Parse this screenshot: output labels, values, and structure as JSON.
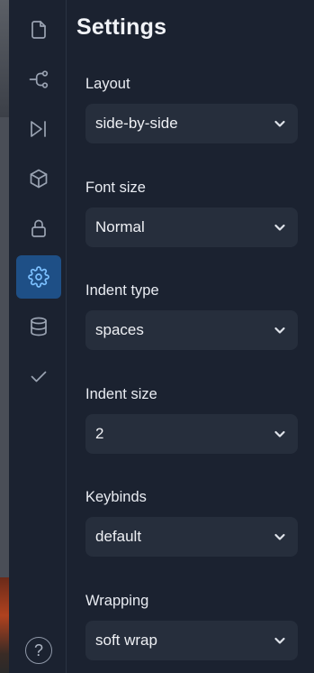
{
  "activity_bar": {
    "items": [
      {
        "name": "file-icon"
      },
      {
        "name": "git-branch-icon"
      },
      {
        "name": "run-next-icon"
      },
      {
        "name": "package-icon"
      },
      {
        "name": "lock-icon"
      },
      {
        "name": "settings-gear-icon",
        "active": true
      },
      {
        "name": "database-icon"
      },
      {
        "name": "checkmark-icon"
      }
    ],
    "help_symbol": "?"
  },
  "settings": {
    "title": "Settings",
    "fields": [
      {
        "label": "Layout",
        "value": "side-by-side"
      },
      {
        "label": "Font size",
        "value": "Normal"
      },
      {
        "label": "Indent type",
        "value": "spaces"
      },
      {
        "label": "Indent size",
        "value": "2"
      },
      {
        "label": "Keybinds",
        "value": "default"
      },
      {
        "label": "Wrapping",
        "value": "soft wrap"
      }
    ]
  },
  "colors": {
    "background": "#1b2230",
    "select_background": "#262e3c",
    "active_item": "#1e4f86",
    "active_icon": "#7cc0ff"
  }
}
